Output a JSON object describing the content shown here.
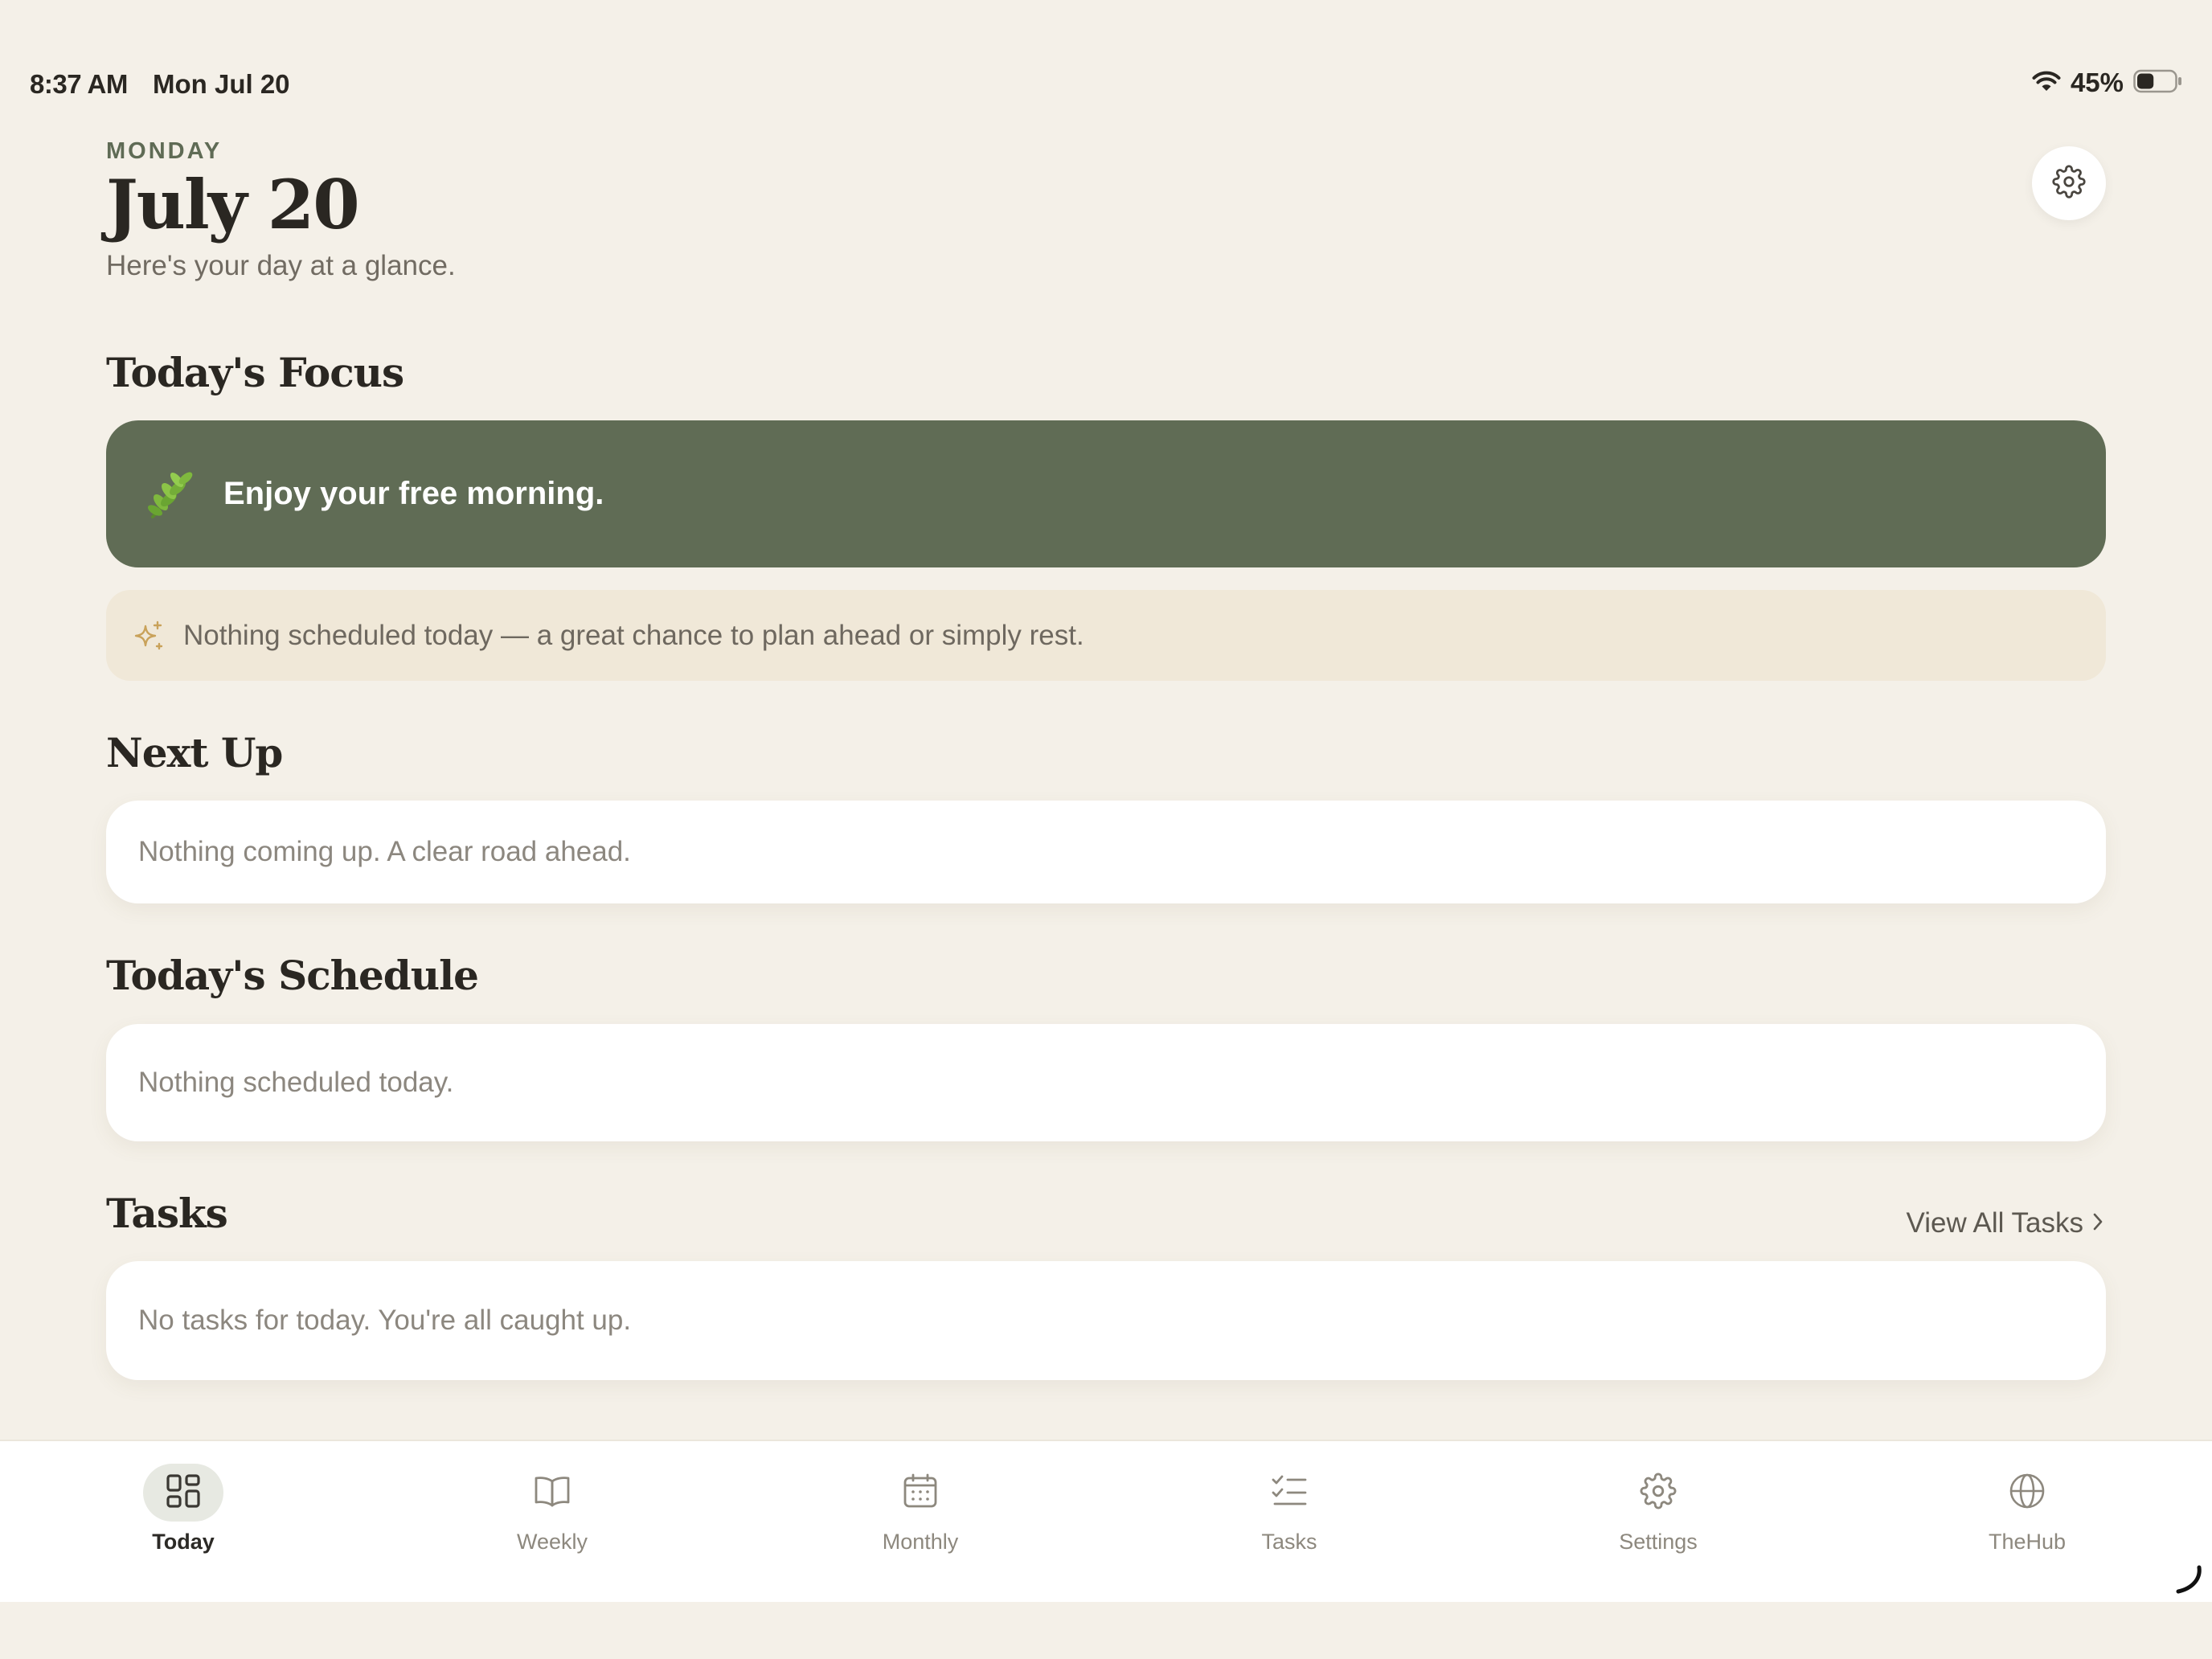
{
  "status_bar": {
    "time": "8:37 AM",
    "date": "Mon Jul 20",
    "battery_percent": "45%",
    "battery_level": 0.45
  },
  "header": {
    "weekday": "MONDAY",
    "date_title": "July 20",
    "subtitle": "Here's your day at a glance."
  },
  "focus": {
    "title": "Today's Focus",
    "card_text": "Enjoy your free morning.",
    "hint_text": "Nothing scheduled today — a great chance to plan ahead or simply rest."
  },
  "next_up": {
    "title": "Next Up",
    "empty_text": "Nothing coming up. A clear road ahead."
  },
  "schedule": {
    "title": "Today's Schedule",
    "empty_text": "Nothing scheduled today."
  },
  "tasks": {
    "title": "Tasks",
    "view_all_label": "View All Tasks",
    "empty_text": "No tasks for today. You're all caught up."
  },
  "tab_bar": {
    "items": [
      {
        "label": "Today",
        "icon": "grid-icon",
        "active": true
      },
      {
        "label": "Weekly",
        "icon": "book-icon",
        "active": false
      },
      {
        "label": "Monthly",
        "icon": "calendar-icon",
        "active": false
      },
      {
        "label": "Tasks",
        "icon": "checklist-icon",
        "active": false
      },
      {
        "label": "Settings",
        "icon": "gear-icon",
        "active": false
      },
      {
        "label": "TheHub",
        "icon": "globe-icon",
        "active": false
      }
    ]
  },
  "colors": {
    "background": "#f4f0e8",
    "focus_card": "#606c55",
    "hint_card": "#f0e8d8",
    "accent_sparkle": "#c9a25a",
    "text_primary": "#2a2722",
    "text_muted": "#8c877f"
  }
}
